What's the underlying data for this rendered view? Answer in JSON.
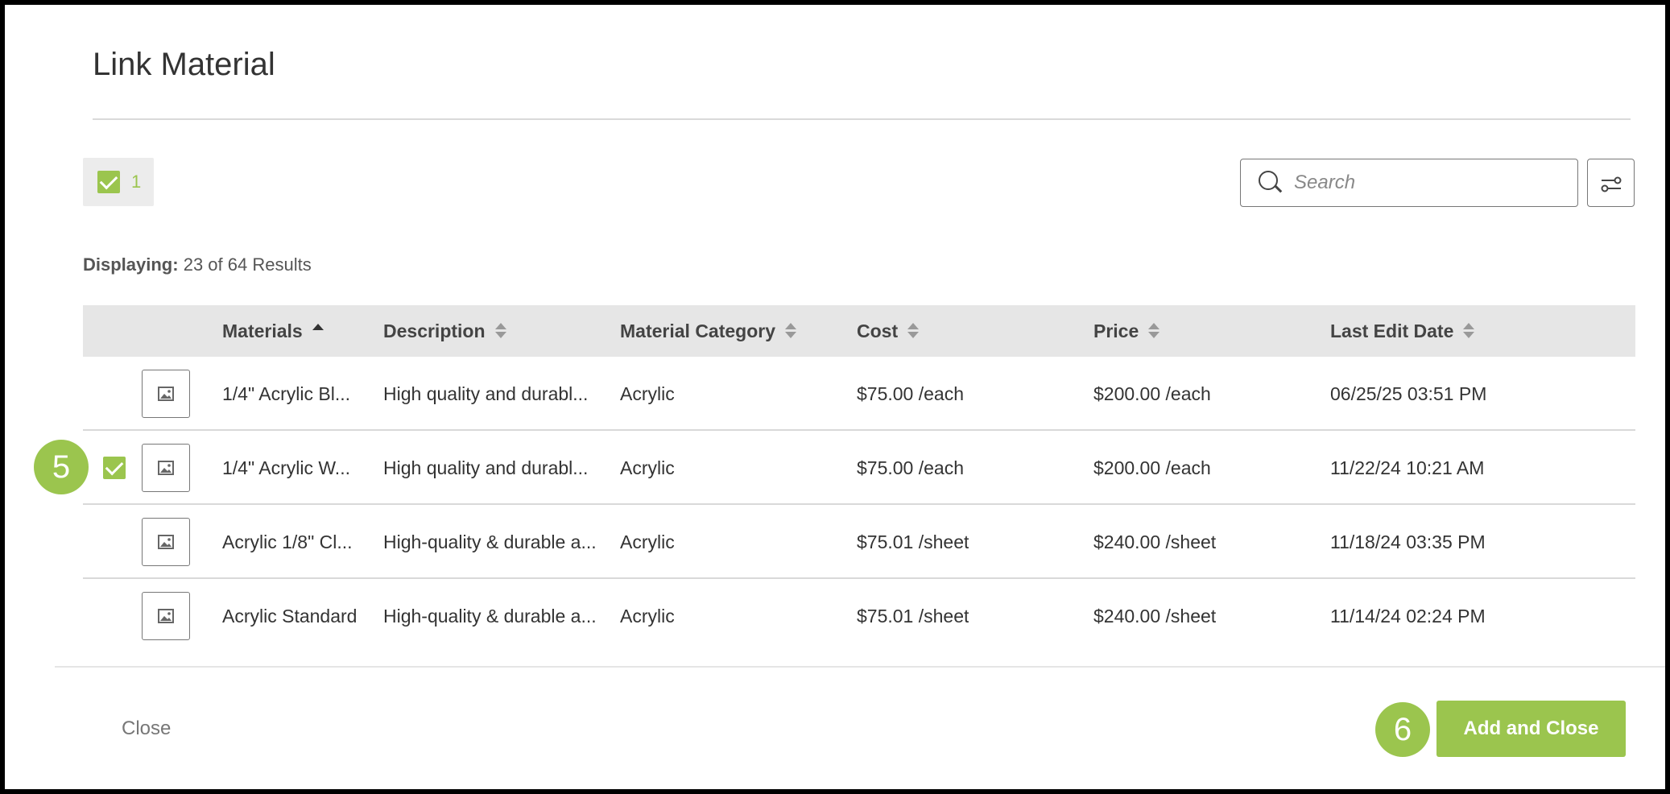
{
  "dialog": {
    "title": "Link Material"
  },
  "selection": {
    "count": "1"
  },
  "search": {
    "placeholder": "Search"
  },
  "results": {
    "label": "Displaying:",
    "text": "23 of 64 Results"
  },
  "table": {
    "columns": [
      {
        "label": "Materials",
        "sort": "ascending"
      },
      {
        "label": "Description",
        "sort": "none"
      },
      {
        "label": "Material Category",
        "sort": "none"
      },
      {
        "label": "Cost",
        "sort": "none"
      },
      {
        "label": "Price",
        "sort": "none"
      },
      {
        "label": "Last Edit Date",
        "sort": "none"
      }
    ],
    "rows": [
      {
        "checked": false,
        "material": "1/4\" Acrylic Bl...",
        "description": "High quality and durabl...",
        "category": "Acrylic",
        "cost": "$75.00 /each",
        "price": "$200.00 /each",
        "date": "06/25/25 03:51 PM"
      },
      {
        "checked": true,
        "material": "1/4\" Acrylic W...",
        "description": "High quality and durabl...",
        "category": "Acrylic",
        "cost": "$75.00 /each",
        "price": "$200.00 /each",
        "date": "11/22/24 10:21 AM"
      },
      {
        "checked": false,
        "material": "Acrylic 1/8\" Cl...",
        "description": "High-quality & durable a...",
        "category": "Acrylic",
        "cost": "$75.01 /sheet",
        "price": "$240.00 /sheet",
        "date": "11/18/24 03:35 PM"
      },
      {
        "checked": false,
        "material": "Acrylic Standard",
        "description": "High-quality & durable a...",
        "category": "Acrylic",
        "cost": "$75.01 /sheet",
        "price": "$240.00 /sheet",
        "date": "11/14/24 02:24 PM"
      }
    ]
  },
  "steps": {
    "select_row": "5",
    "add_close": "6"
  },
  "footer": {
    "close_label": "Close",
    "add_close_label": "Add and Close"
  },
  "colors": {
    "accent": "#9bc54e",
    "header_bg": "#e6e6e6"
  }
}
